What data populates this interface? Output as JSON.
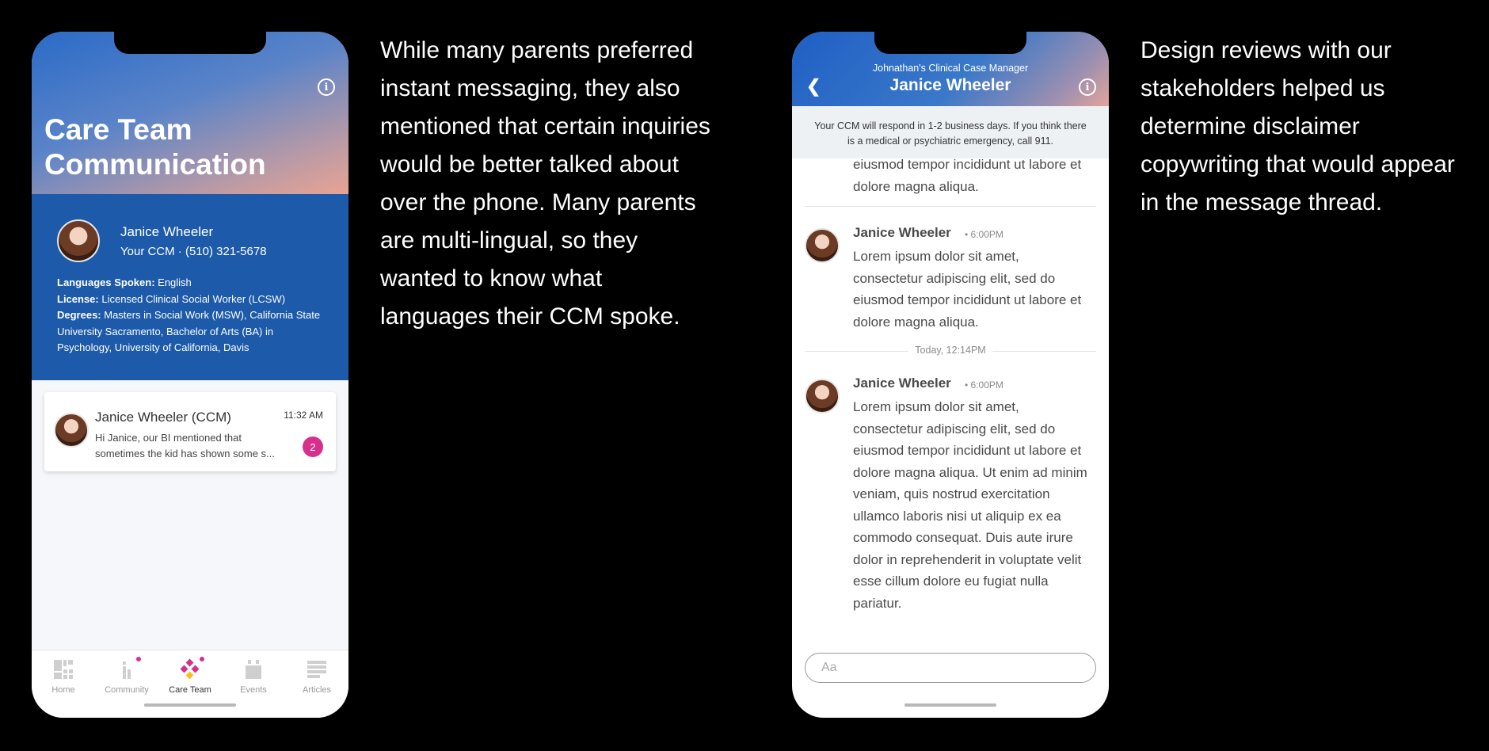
{
  "left_phone": {
    "title": "Care Team Communication",
    "profile": {
      "name": "Janice Wheeler",
      "role_phone": "Your CCM · (510) 321-5678",
      "languages_label": "Languages Spoken:",
      "languages_value": " English",
      "license_label": "License:",
      "license_value": " Licensed Clinical Social Worker (LCSW)",
      "degrees_label": "Degrees:",
      "degrees_value": " Masters in Social Work (MSW), California State University Sacramento, Bachelor of Arts (BA) in Psychology, University of California, Davis"
    },
    "message_card": {
      "name": "Janice Wheeler (CCM)",
      "time": "11:32 AM",
      "preview": "Hi Janice, our BI mentioned that sometimes the kid has shown some s...",
      "unread": "2"
    },
    "tabs": [
      {
        "label": "Home",
        "icon": "home-grid-icon"
      },
      {
        "label": "Community",
        "icon": "community-icon"
      },
      {
        "label": "Care Team",
        "icon": "care-team-icon"
      },
      {
        "label": "Events",
        "icon": "calendar-icon"
      },
      {
        "label": "Articles",
        "icon": "articles-icon"
      }
    ],
    "active_tab": "Care Team",
    "colors": {
      "accent": "#d6308c",
      "profile_bg": "#1d5aaa"
    }
  },
  "caption_left": "While many parents preferred instant messaging, they also mentioned that certain inquiries would be better talked about over the phone. Many parents are multi-lingual, so they wanted to know what languages their CCM spoke.",
  "right_phone": {
    "subtitle": "Johnathan's Clinical Case Manager",
    "title": "Janice Wheeler",
    "disclaimer": "Your CCM will respond in 1-2 business days. If you think there is a medical or psychiatric emergency, call 911.",
    "thread": {
      "partial_text": "eiusmod tempor incididunt ut labore et dolore magna aliqua.",
      "messages": [
        {
          "author": "Janice Wheeler",
          "time": "6:00PM",
          "text": "Lorem ipsum dolor sit amet, consectetur adipiscing elit, sed do eiusmod tempor incididunt ut labore et dolore magna aliqua."
        },
        {
          "author": "Janice Wheeler",
          "time": "6:00PM",
          "text": "Lorem ipsum dolor sit amet, consectetur adipiscing elit, sed do eiusmod tempor incididunt ut labore et dolore magna aliqua. Ut enim ad minim veniam, quis nostrud exercitation ullamco laboris nisi ut aliquip ex ea commodo consequat. Duis aute irure dolor in reprehenderit in voluptate velit esse cillum dolore eu fugiat nulla pariatur."
        }
      ],
      "today_label": "Today, 12:14PM"
    },
    "composer_placeholder": "Aa"
  },
  "caption_right": "Design reviews with our stakeholders helped us determine disclaimer copywriting that would appear in the message thread."
}
